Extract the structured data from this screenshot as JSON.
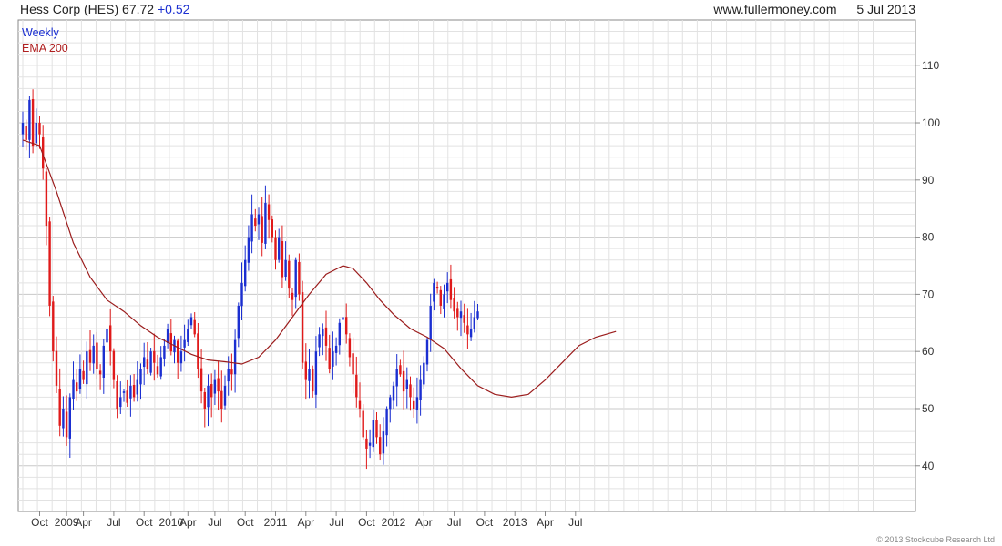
{
  "header": {
    "title": "Hess Corp (HES)",
    "price": "67.72",
    "change": "+0.52",
    "site": "www.fullermoney.com",
    "date": "5 Jul 2013"
  },
  "legend": {
    "frequency": "Weekly",
    "ema": "EMA 200"
  },
  "copyright": "© 2013 Stockcube Research Ltd",
  "colors": {
    "up": "#1b2fd1",
    "down": "#e01a1a",
    "ema": "#9b1c1c",
    "grid": "#e2e2e2",
    "axis": "#888888"
  },
  "chart_data": {
    "type": "candlestick",
    "y_axis": {
      "min": 32,
      "max": 118,
      "position": "right",
      "ticks": [
        40,
        50,
        60,
        70,
        80,
        90,
        100,
        110
      ]
    },
    "x_axis": {
      "weeks_total": 256,
      "labels": [
        {
          "text": "Oct",
          "week": 5
        },
        {
          "text": "2009",
          "week": 13
        },
        {
          "text": "Apr",
          "week": 18
        },
        {
          "text": "Jul",
          "week": 27
        },
        {
          "text": "Oct",
          "week": 36
        },
        {
          "text": "2010",
          "week": 44
        },
        {
          "text": "Apr",
          "week": 49
        },
        {
          "text": "Jul",
          "week": 57
        },
        {
          "text": "Oct",
          "week": 66
        },
        {
          "text": "2011",
          "week": 75
        },
        {
          "text": "Apr",
          "week": 84
        },
        {
          "text": "Jul",
          "week": 93
        },
        {
          "text": "Oct",
          "week": 102
        },
        {
          "text": "2012",
          "week": 110
        },
        {
          "text": "Apr",
          "week": 119
        },
        {
          "text": "Jul",
          "week": 128
        },
        {
          "text": "Oct",
          "week": 137
        },
        {
          "text": "2013",
          "week": 146
        },
        {
          "text": "Apr",
          "week": 155
        },
        {
          "text": "Jul",
          "week": 164
        }
      ]
    },
    "closes": [
      100,
      97,
      104,
      96,
      100,
      98,
      92,
      82,
      68,
      60,
      54,
      47,
      50,
      45,
      52,
      55,
      53,
      57,
      55,
      60,
      58,
      61,
      57,
      56,
      61,
      64,
      60,
      55,
      50,
      52,
      53,
      51,
      54,
      52,
      55,
      57,
      59,
      57,
      60,
      58,
      56,
      59,
      61,
      64,
      60,
      62,
      58,
      60,
      62,
      64,
      66,
      63,
      57,
      53,
      50,
      54,
      52,
      55,
      53,
      50,
      54,
      57,
      56,
      62,
      68,
      72,
      76,
      80,
      84,
      82,
      84,
      79,
      86,
      83,
      80,
      76,
      80,
      73,
      76,
      71,
      69,
      76,
      70,
      58,
      55,
      57,
      53,
      60,
      63,
      64,
      61,
      57,
      60,
      61,
      65,
      66,
      63,
      59,
      56,
      52,
      50,
      45,
      43,
      44,
      48,
      45,
      42,
      46,
      50,
      52,
      54,
      57,
      56,
      53,
      55,
      52,
      50,
      52,
      55,
      58,
      62,
      68,
      72,
      71,
      68,
      70,
      72,
      69,
      67,
      66,
      67,
      65,
      63,
      64,
      66,
      67
    ],
    "ema_200": {
      "anchors": [
        {
          "w": 0,
          "v": 97
        },
        {
          "w": 5,
          "v": 96
        },
        {
          "w": 10,
          "v": 88
        },
        {
          "w": 15,
          "v": 79
        },
        {
          "w": 20,
          "v": 73
        },
        {
          "w": 25,
          "v": 69
        },
        {
          "w": 30,
          "v": 67
        },
        {
          "w": 35,
          "v": 64.5
        },
        {
          "w": 40,
          "v": 62.5
        },
        {
          "w": 45,
          "v": 61
        },
        {
          "w": 50,
          "v": 59.5
        },
        {
          "w": 55,
          "v": 58.5
        },
        {
          "w": 60,
          "v": 58.2
        },
        {
          "w": 65,
          "v": 57.8
        },
        {
          "w": 70,
          "v": 59
        },
        {
          "w": 75,
          "v": 62
        },
        {
          "w": 80,
          "v": 66
        },
        {
          "w": 85,
          "v": 70
        },
        {
          "w": 90,
          "v": 73.5
        },
        {
          "w": 95,
          "v": 75
        },
        {
          "w": 98,
          "v": 74.5
        },
        {
          "w": 102,
          "v": 72
        },
        {
          "w": 106,
          "v": 69
        },
        {
          "w": 110,
          "v": 66.5
        },
        {
          "w": 115,
          "v": 64
        },
        {
          "w": 120,
          "v": 62.5
        },
        {
          "w": 125,
          "v": 60.5
        },
        {
          "w": 130,
          "v": 57
        },
        {
          "w": 135,
          "v": 54
        },
        {
          "w": 140,
          "v": 52.5
        },
        {
          "w": 145,
          "v": 52
        },
        {
          "w": 150,
          "v": 52.5
        },
        {
          "w": 155,
          "v": 55
        },
        {
          "w": 160,
          "v": 58
        },
        {
          "w": 165,
          "v": 61
        },
        {
          "w": 170,
          "v": 62.5
        },
        {
          "w": 176,
          "v": 63.5
        }
      ]
    }
  }
}
